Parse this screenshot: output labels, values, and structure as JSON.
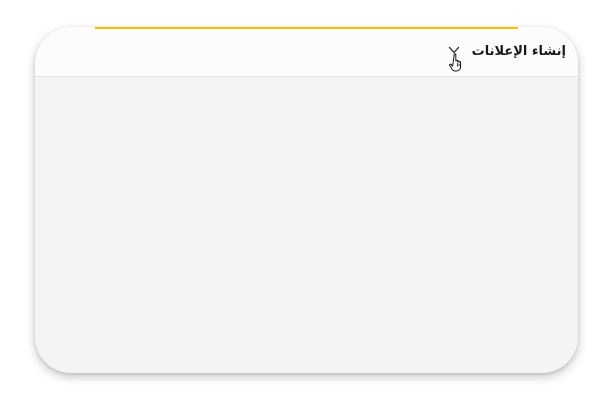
{
  "panel": {
    "title": "إنشاء الإعلانات",
    "expand_icon": "chevron-down-icon",
    "pointer_icon": "hand-pointer-icon"
  },
  "colors": {
    "accent": "#f2c200",
    "header_bg": "#fcfcfc",
    "body_bg": "#f4f4f4"
  }
}
